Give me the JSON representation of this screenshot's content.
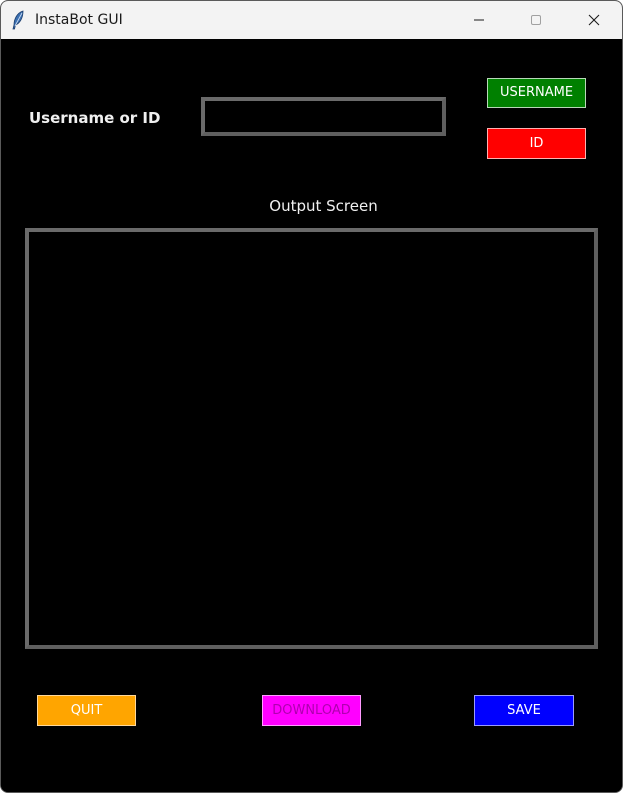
{
  "window": {
    "title": "InstaBot GUI",
    "icon": "feather-icon"
  },
  "titlebar_controls": {
    "minimize_icon": "minimize-icon",
    "maximize_icon": "maximize-icon",
    "close_icon": "close-icon"
  },
  "form": {
    "username_label": "Username or ID",
    "username_value": "",
    "username_button": "USERNAME",
    "id_button": "ID"
  },
  "output": {
    "label": "Output Screen",
    "content": ""
  },
  "footer": {
    "quit_button": "QUIT",
    "download_button": "DOWNLOAD",
    "save_button": "SAVE"
  },
  "colors": {
    "background": "#000000",
    "username_button": "#008000",
    "id_button": "#ff0000",
    "quit_button": "#ffa500",
    "download_button": "#ff00ff",
    "save_button": "#0000ff"
  }
}
